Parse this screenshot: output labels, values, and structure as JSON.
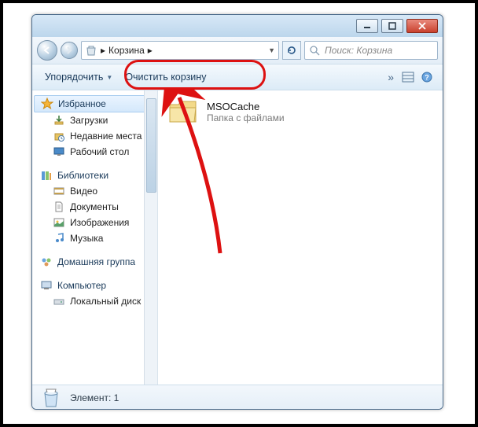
{
  "window": {
    "location_label": "Корзина",
    "breadcrumb_sep": "▸",
    "search_placeholder": "Поиск: Корзина"
  },
  "toolbar": {
    "organize": "Упорядочить",
    "empty_bin": "Очистить корзину"
  },
  "sidebar": {
    "favorites": "Избранное",
    "fav_items": [
      "Загрузки",
      "Недавние места",
      "Рабочий стол"
    ],
    "libraries": "Библиотеки",
    "lib_items": [
      "Видео",
      "Документы",
      "Изображения",
      "Музыка"
    ],
    "homegroup": "Домашняя группа",
    "computer": "Компьютер",
    "comp_items": [
      "Локальный диск"
    ]
  },
  "content": {
    "items": [
      {
        "name": "MSOCache",
        "subtitle": "Папка с файлами"
      }
    ]
  },
  "status": {
    "text": "Элемент: 1"
  }
}
